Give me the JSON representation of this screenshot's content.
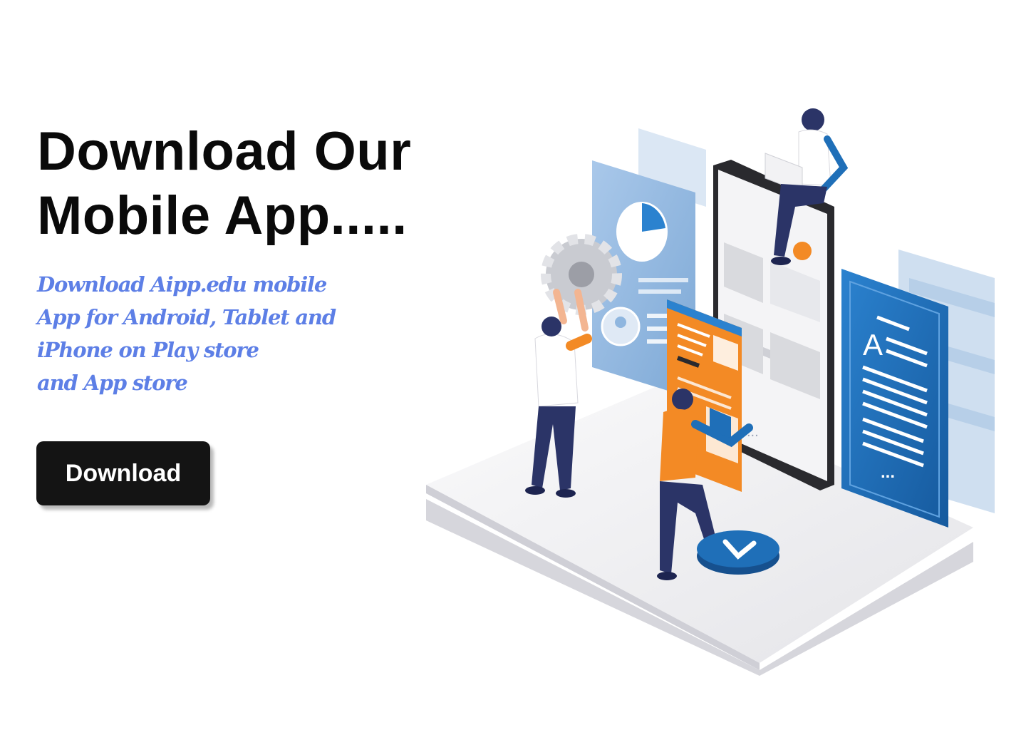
{
  "hero": {
    "title_lines": [
      "Download Our",
      "Mobile App....."
    ],
    "description_lines": [
      "Download Aipp.edu mobile",
      "App for Android, Tablet and",
      "iPhone on Play store",
      "and App store"
    ],
    "button_label": "Download"
  },
  "illustration": {
    "doc_letter": "A",
    "dots": "...",
    "colors": {
      "accent_blue": "#1f6fb8",
      "light_blue": "#8fb6df",
      "orange": "#f38a25",
      "navy": "#2b3467",
      "platform": "#ececf0"
    }
  },
  "theme": {
    "title_color": "#0a0a0a",
    "description_color": "#5d7fe6",
    "button_bg": "#141414",
    "button_text": "#ffffff"
  }
}
